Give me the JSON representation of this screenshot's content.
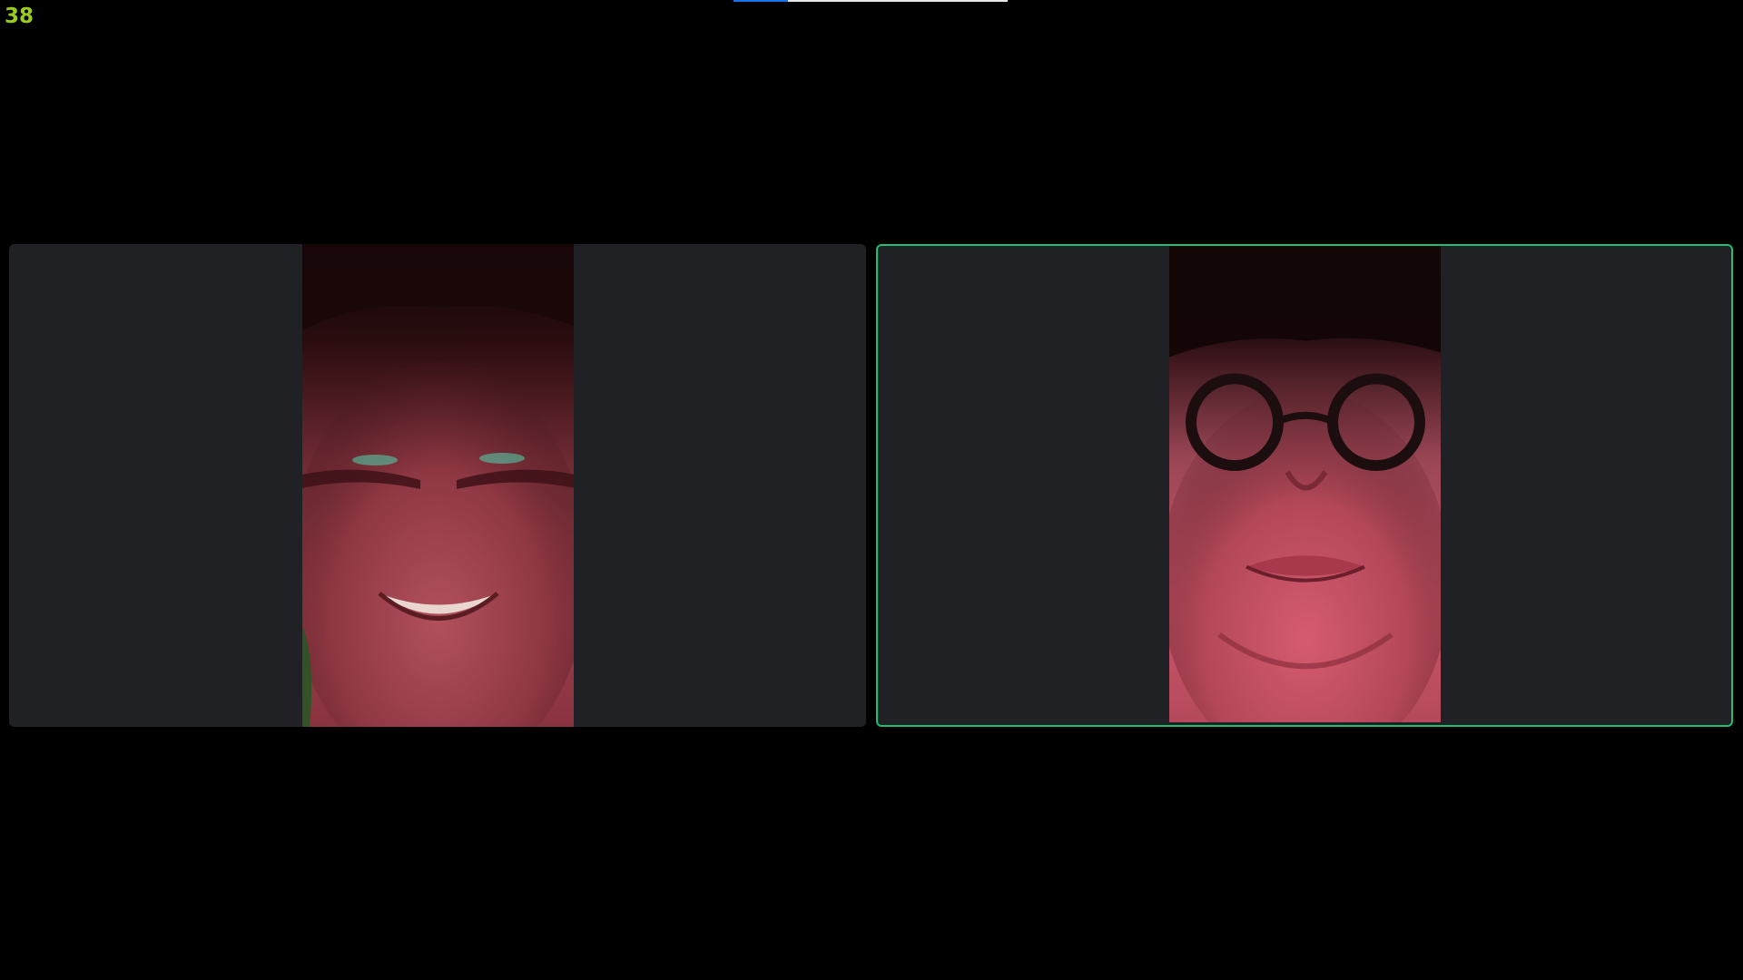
{
  "stats": {
    "fps_value": "38",
    "fps_color": "#9ccc1a"
  },
  "top_progress": {
    "value_fraction": 0.2
  },
  "tile_colors": {
    "background": "#202124",
    "active_speaker_border": "#1dbf73"
  }
}
